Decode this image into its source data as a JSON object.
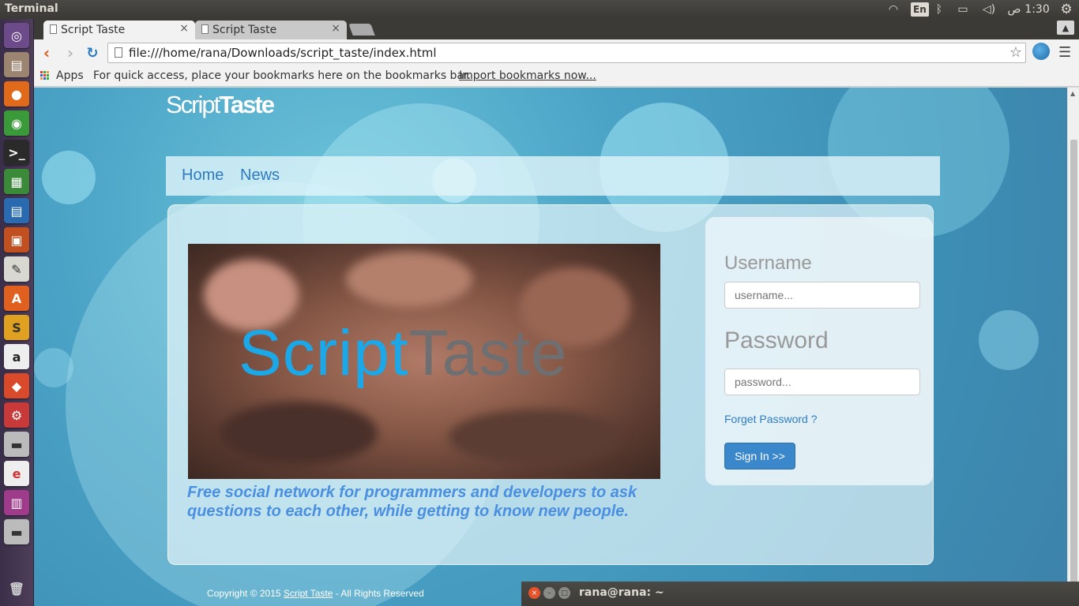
{
  "panel": {
    "title": "Terminal",
    "lang": "En",
    "arabic_am": "ص",
    "clock": "1:30"
  },
  "browser": {
    "tabs": [
      {
        "label": "Script Taste",
        "close": "×"
      },
      {
        "label": "Script Taste",
        "close": "×"
      }
    ],
    "url": "file:///home/rana/Downloads/script_taste/index.html",
    "bookmarks": {
      "apps_label": "Apps",
      "hint": "For quick access, place your bookmarks here on the bookmarks bar.",
      "import_link": "Import bookmarks now..."
    }
  },
  "site": {
    "logo_light": "Script",
    "logo_bold": "Taste",
    "nav": [
      "Home",
      "News"
    ],
    "hero_logo_script": "Script",
    "hero_logo_taste": "Taste",
    "tagline": "Free social network for programmers and developers to ask questions to each other, while getting to know new people.",
    "login": {
      "username_label": "Username",
      "username_placeholder": "username...",
      "password_label": "Password",
      "password_placeholder": "password...",
      "forgot": "Forget Password ?",
      "signin": "Sign In >>"
    },
    "footer": {
      "prefix": "Copyright © 2015 ",
      "link": "Script Taste",
      "suffix": " - All Rights Reserved"
    }
  },
  "terminal": {
    "title": "rana@rana: ~"
  },
  "colors": {
    "accent_blue": "#3a87cc",
    "logo_cyan": "#1aa8e8",
    "tagline_blue": "#4a8fe0"
  }
}
